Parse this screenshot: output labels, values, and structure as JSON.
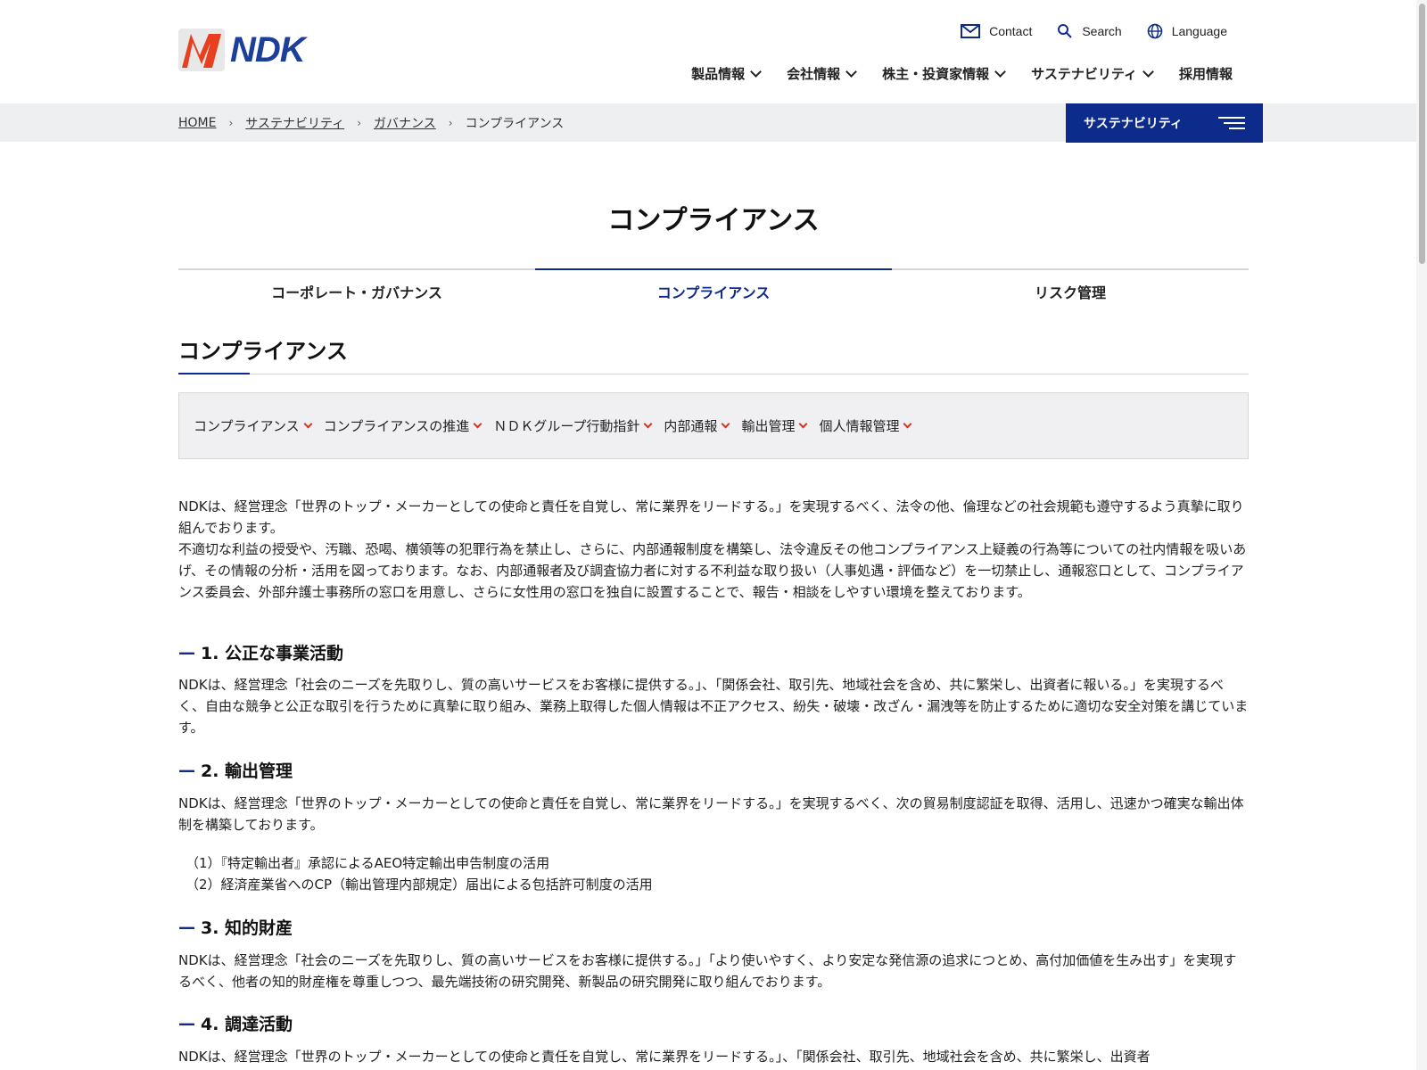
{
  "header": {
    "logo_text": "NDK",
    "utility": [
      {
        "label": "Contact",
        "icon": "mail-icon"
      },
      {
        "label": "Search",
        "icon": "search-icon"
      },
      {
        "label": "Language",
        "icon": "globe-icon"
      }
    ],
    "nav": [
      {
        "label": "製品情報"
      },
      {
        "label": "会社情報"
      },
      {
        "label": "株主・投資家情報"
      },
      {
        "label": "サステナビリティ"
      },
      {
        "label": "採用情報"
      }
    ]
  },
  "breadcrumb": {
    "items": [
      "HOME",
      "サステナビリティ",
      "ガバナンス"
    ],
    "current": "コンプライアンス"
  },
  "section_menu_button": "サステナビリティ",
  "page_title": "コンプライアンス",
  "tabs": [
    {
      "label": "コーポレート・ガバナンス"
    },
    {
      "label": "コンプライアンス"
    },
    {
      "label": "リスク管理"
    }
  ],
  "section_heading": "コンプライアンス",
  "anchors": [
    "コンプライアンス",
    "コンプライアンスの推進",
    "ＮＤＫグループ行動指針",
    "内部通報",
    "輸出管理",
    "個人情報管理"
  ],
  "intro": {
    "p1": "NDKは、経営理念「世界のトップ・メーカーとしての使命と責任を自覚し、常に業界をリードする。」を実現するべく、法令の他、倫理などの社会規範も遵守するよう真摯に取り組んでおります。",
    "p2": "不適切な利益の授受や、汚職、恐喝、横領等の犯罪行為を禁止し、さらに、内部通報制度を構築し、法令違反その他コンプライアンス上疑義の行為等についての社内情報を吸いあげ、その情報の分析・活用を図っております。なお、内部通報者及び調査協力者に対する不利益な取り扱い（人事処遇・評価など）を一切禁止し、通報窓口として、コンプライアンス委員会、外部弁護士事務所の窓口を用意し、さらに女性用の窓口を独自に設置することで、報告・相談をしやすい環境を整えております。"
  },
  "sections": [
    {
      "dash": "—",
      "title": "1. 公正な事業活動",
      "body": "NDKは、経営理念「社会のニーズを先取りし、質の高いサービスをお客様に提供する。」、「関係会社、取引先、地域社会を含め、共に繁栄し、出資者に報いる。」を実現するべく、自由な競争と公正な取引を行うために真摯に取り組み、業務上取得した個人情報は不正アクセス、紛失・破壊・改ざん・漏洩等を防止するために適切な安全対策を講じています。"
    },
    {
      "dash": "—",
      "title": "2. 輸出管理",
      "body": "NDKは、経営理念「世界のトップ・メーカーとしての使命と責任を自覚し、常に業界をリードする。」を実現するべく、次の貿易制度認証を取得、活用し、迅速かつ確実な輸出体制を構築しております。",
      "list": [
        "（1）『特定輸出者』承認によるAEO特定輸出申告制度の活用",
        "（2）経済産業省へのCP（輸出管理内部規定）届出による包括許可制度の活用"
      ]
    },
    {
      "dash": "—",
      "title": "3. 知的財産",
      "body": "NDKは、経営理念「社会のニーズを先取りし、質の高いサービスをお客様に提供する。」「より使いやすく、より安定な発信源の追求につとめ、高付加価値を生み出す」を実現するべく、他者の知的財産権を尊重しつつ、最先端技術の研究開発、新製品の研究開発に取り組んでおります。"
    },
    {
      "dash": "—",
      "title": "4. 調達活動",
      "body": "NDKは、経営理念「世界のトップ・メーカーとしての使命と責任を自覚し、常に業界をリードする。」、「関係会社、取引先、地域社会を含め、共に繁栄し、出資者"
    }
  ],
  "colors": {
    "brand_navy": "#0d2b8a",
    "accent_red": "#d6321c",
    "breadcrumb_bg": "#eeeff1"
  }
}
